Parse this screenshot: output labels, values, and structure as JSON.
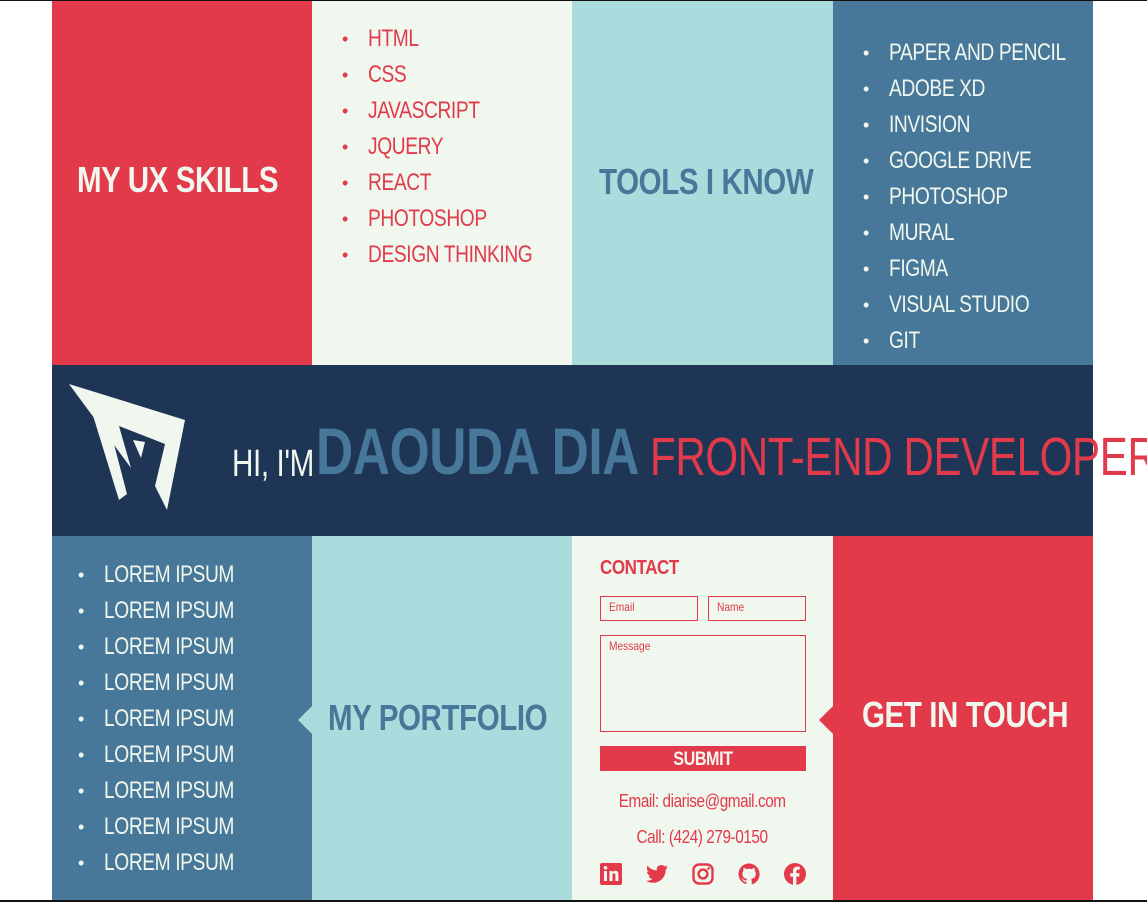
{
  "colors": {
    "red": "#e23a4a",
    "cream": "#f0f7ee",
    "teal": "#aadcde",
    "blue": "#487899",
    "navy": "#1f3556"
  },
  "skills": {
    "heading": "MY UX SKILLS",
    "items": [
      "HTML",
      "CSS",
      "JAVASCRIPT",
      "JQUERY",
      "REACT",
      "PHOTOSHOP",
      "DESIGN THINKING"
    ]
  },
  "tools": {
    "heading": "TOOLS I KNOW",
    "items": [
      "PAPER AND PENCIL",
      "ADOBE XD",
      "INVISION",
      "GOOGLE DRIVE",
      "PHOTOSHOP",
      "MURAL",
      "FIGMA",
      "VISUAL STUDIO",
      "GIT"
    ]
  },
  "hero": {
    "logo_icon": "stylized-v-logo",
    "greeting": "HI, I'M",
    "name": "DAOUDA DIA",
    "role": "FRONT-END DEVELOPER"
  },
  "portfolio": {
    "heading": "MY PORTFOLIO",
    "items": [
      "LOREM IPSUM",
      "LOREM IPSUM",
      "LOREM IPSUM",
      "LOREM IPSUM",
      "LOREM IPSUM",
      "LOREM IPSUM",
      "LOREM IPSUM",
      "LOREM IPSUM",
      "LOREM IPSUM"
    ]
  },
  "contact": {
    "title": "CONTACT",
    "email_placeholder": "Email",
    "name_placeholder": "Name",
    "message_placeholder": "Message",
    "submit_label": "SUBMIT",
    "email_line": "Email: diarise@gmail.com",
    "phone_line": "Call: (424) 279-0150",
    "social_icons": [
      "linkedin-icon",
      "twitter-icon",
      "instagram-icon",
      "github-icon",
      "facebook-icon"
    ]
  },
  "get_in_touch": {
    "heading": "GET IN TOUCH"
  }
}
